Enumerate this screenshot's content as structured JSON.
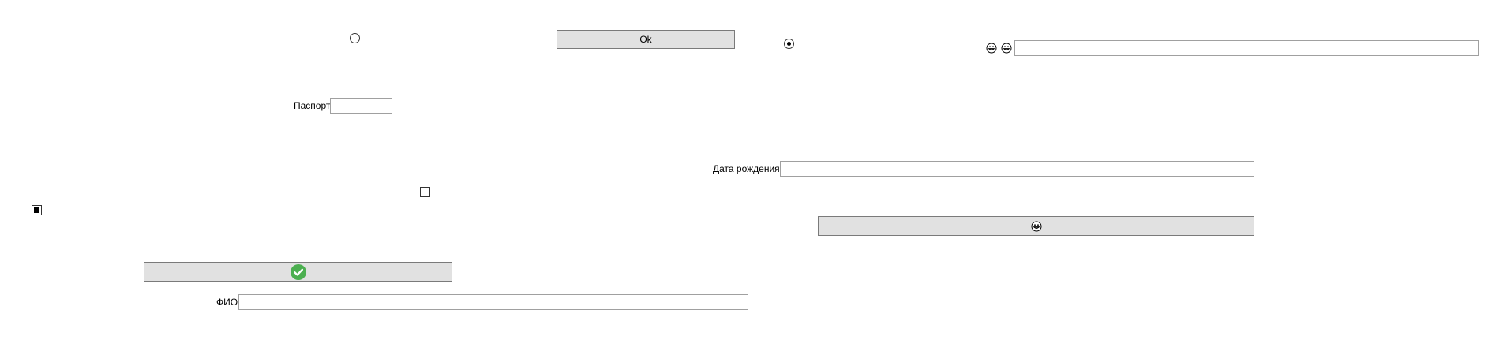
{
  "buttons": {
    "ok_label": "Ok",
    "emoji_button_icon": "grinning-emoji-icon",
    "check_button_icon": "green-checkmark-icon"
  },
  "fields": {
    "passport_label": "Паспорт",
    "passport_value": "",
    "birthdate_label": "Дата рождения",
    "birthdate_value": "",
    "fio_label": "ФИО",
    "fio_value": "",
    "top_right_value": ""
  },
  "radios": {
    "top_left_selected": false,
    "top_right_selected": true
  },
  "checkboxes": {
    "left_checked": true,
    "middle_checked": false
  },
  "icons": {
    "top_right_1": "grinning-emoji-icon",
    "top_right_2": "grinning-emoji-icon"
  },
  "colors": {
    "check_green": "#4caf50",
    "button_bg": "#e1e1e1"
  }
}
